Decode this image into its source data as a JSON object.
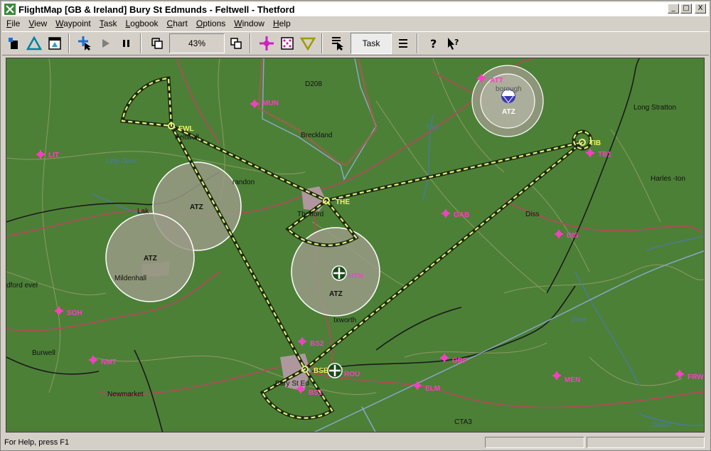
{
  "window": {
    "title": "FlightMap  [GB & Ireland]  Bury St Edmunds - Feltwell - Thetford",
    "minimize_glyph": "_",
    "maximize_glyph": "□",
    "close_glyph": "X"
  },
  "menu": [
    {
      "label": "File"
    },
    {
      "label": "View"
    },
    {
      "label": "Waypoint"
    },
    {
      "label": "Task"
    },
    {
      "label": "Logbook"
    },
    {
      "label": "Chart"
    },
    {
      "label": "Options"
    },
    {
      "label": "Window"
    },
    {
      "label": "Help"
    }
  ],
  "toolbar": {
    "zoom_value": "43%",
    "task_label": "Task"
  },
  "map": {
    "place_labels": {
      "d208": "D208",
      "breckland": "Breckland",
      "feltwell": "Feltwell",
      "brandon": "randon",
      "lakenheath": "Lak",
      "thetford": "Thetford",
      "mildenhall": "Mildenhall",
      "ixworth": "Ixworth",
      "burwell": "Burwell",
      "newmarket": "Newmarket",
      "bury": "Bury St Ed",
      "diss": "Diss",
      "long_stratton": "Long Stratton",
      "harleston": "Harles -ton",
      "lt_ouse": "Little Ouse",
      "thet": "Thet",
      "dove": "Dove",
      "deben": "Deben",
      "cta3": "CTA3",
      "ford_level": "dford evel",
      "borough": "borough"
    },
    "atz_label": "ATZ",
    "waypoints": {
      "fwl": "FWL",
      "the": "THE",
      "tib": "TIB",
      "bse": "BSE",
      "mun": "MUN",
      "lit": "LIT",
      "att": "ATT",
      "tb1": "TB1",
      "gab": "GAB",
      "dis": "DIS",
      "htn": "HTN",
      "soh": "SOH",
      "nmt": "NMT",
      "bs2": "BS2",
      "bs1": "BS1",
      "rou": "ROU",
      "grf": "GRF",
      "elm": "ELM",
      "men": "MEN",
      "frw": "FRW"
    }
  },
  "status": {
    "help_text": "For Help, press F1"
  },
  "colors": {
    "map_green": "#4c8037",
    "task_line": "#e8f080",
    "waypoint_magenta": "#ff3cc8",
    "atz_fill": "#9a9a86"
  }
}
